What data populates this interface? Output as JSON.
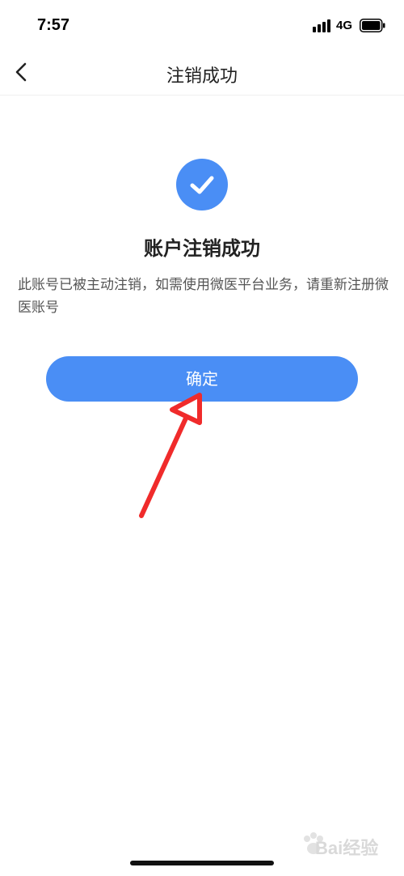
{
  "status_bar": {
    "time": "7:57",
    "network": "4G"
  },
  "nav": {
    "title": "注销成功"
  },
  "result": {
    "title": "账户注销成功",
    "description": "此账号已被主动注销，如需使用微医平台业务，请重新注册微医账号"
  },
  "actions": {
    "confirm_label": "确定"
  },
  "watermark": {
    "text": "Bai经验"
  },
  "colors": {
    "primary": "#4a8ef5",
    "annotation": "#f02b2b"
  }
}
